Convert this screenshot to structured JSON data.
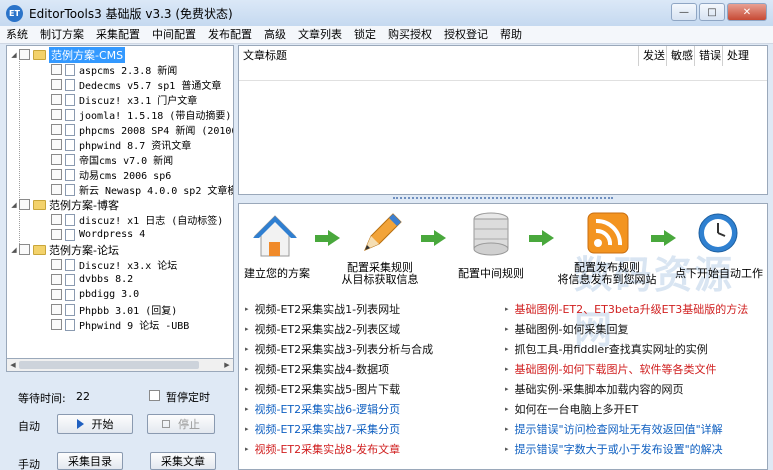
{
  "window": {
    "app_icon": "ET",
    "title": "EditorTools3 基础版 v3.3 (免费状态)",
    "buttons": {
      "minimize": "—",
      "maximize": "□",
      "close": "✕"
    }
  },
  "menu": [
    "系统",
    "制订方案",
    "采集配置",
    "中间配置",
    "发布配置",
    "高级",
    "文章列表",
    "锁定",
    "购买授权",
    "授权登记",
    "帮助"
  ],
  "tree": {
    "groups": [
      {
        "label": "范例方案-CMS",
        "items": [
          "aspcms 2.3.8 新闻",
          "Dedecms v5.7 sp1 普通文章",
          "Discuz! x3.1 门户文章",
          "joomla! 1.5.18 (带自动摘要)",
          "phpcms 2008 SP4 新闻 (201005",
          "phpwind 8.7 资讯文章",
          "帝国cms v7.0 新闻",
          "动易cms 2006 sp6",
          "新云 Newasp 4.0.0 sp2 文章模"
        ]
      },
      {
        "label": "范例方案-博客",
        "items": [
          "discuz! x1 日志 (自动标签)",
          "Wordpress 4"
        ]
      },
      {
        "label": "范例方案-论坛",
        "items": [
          "Discuz! x3.x 论坛",
          "dvbbs 8.2",
          "pbdigg 3.0",
          "Phpbb 3.01 (回复)",
          "Phpwind 9 论坛 -UBB"
        ]
      }
    ]
  },
  "controls": {
    "wait_label": "等待时间:",
    "wait_value": "22",
    "pause_timer_label": "暂停定时",
    "auto_label": "自动",
    "start_label": "开始",
    "stop_label": "停止",
    "manual_label": "手动",
    "collect_list_label": "采集目录",
    "collect_article_label": "采集文章"
  },
  "table": {
    "columns": [
      "文章标题",
      "发送",
      "敏感",
      "错误",
      "处理"
    ]
  },
  "steps": [
    {
      "label": "建立您的方案",
      "icon": "house-icon"
    },
    {
      "label": "配置采集规则\n从目标获取信息",
      "icon": "pencil-icon"
    },
    {
      "label": "配置中间规则",
      "icon": "database-icon"
    },
    {
      "label": "配置发布规则\n将信息发布到您网站",
      "icon": "rss-icon"
    },
    {
      "label": "点下开始自动工作",
      "icon": "clock-icon"
    }
  ],
  "links_left": [
    {
      "text": "视频-ET2采集实战1-列表网址",
      "color": "black"
    },
    {
      "text": "视频-ET2采集实战2-列表区域",
      "color": "black"
    },
    {
      "text": "视频-ET2采集实战3-列表分析与合成",
      "color": "black"
    },
    {
      "text": "视频-ET2采集实战4-数据项",
      "color": "black"
    },
    {
      "text": "视频-ET2采集实战5-图片下载",
      "color": "black"
    },
    {
      "text": "视频-ET2采集实战6-逻辑分页",
      "color": "blue"
    },
    {
      "text": "视频-ET2采集实战7-采集分页",
      "color": "blue"
    },
    {
      "text": "视频-ET2采集实战8-发布文章",
      "color": "red"
    }
  ],
  "links_right": [
    {
      "text": "基础图例-ET2、ET3beta升级ET3基础版的方法",
      "color": "red"
    },
    {
      "text": "基础图例-如何采集回复",
      "color": "black"
    },
    {
      "text": "抓包工具-用fiddler查找真实网址的实例",
      "color": "black"
    },
    {
      "text": "基础图例-如何下载图片、软件等各类文件",
      "color": "red"
    },
    {
      "text": "基础实例-采集脚本加载内容的网页",
      "color": "black"
    },
    {
      "text": "如何在一台电脑上多开ET",
      "color": "black"
    },
    {
      "text": "提示错误\"访问检查网址无有效返回值\"详解",
      "color": "blue"
    },
    {
      "text": "提示错误\"字数大于或小于发布设置\"的解决",
      "color": "blue"
    }
  ],
  "watermark": "数码资源网"
}
